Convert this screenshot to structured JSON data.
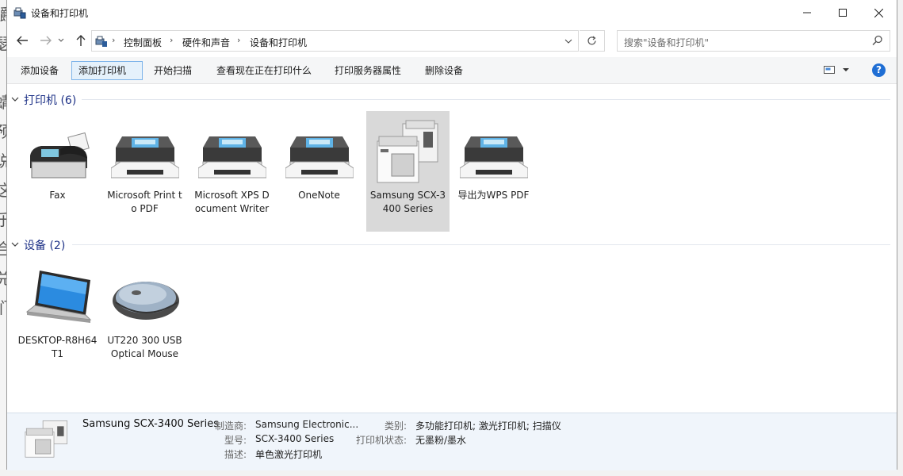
{
  "window": {
    "title": "设备和打印机"
  },
  "background_chars": [
    "嚼",
    "瑟",
    "",
    "蜻",
    "预",
    "说",
    "这",
    "乐",
    "合",
    "兑",
    "们",
    ""
  ],
  "address": {
    "crumbs": [
      "控制面板",
      "硬件和声音",
      "设备和打印机"
    ]
  },
  "search": {
    "placeholder": "搜索\"设备和打印机\""
  },
  "toolbar": {
    "add_device": "添加设备",
    "add_printer": "添加打印机",
    "start_scan": "开始扫描",
    "see_printing": "查看现在正在打印什么",
    "print_server": "打印服务器属性",
    "remove_device": "删除设备",
    "help": "?"
  },
  "printers": {
    "header": "打印机 (6)",
    "items": [
      {
        "label": "Fax",
        "icon": "fax-icon"
      },
      {
        "label": "Microsoft Print to PDF",
        "icon": "printer-icon"
      },
      {
        "label": "Microsoft XPS Document Writer",
        "icon": "printer-icon"
      },
      {
        "label": "OneNote",
        "icon": "printer-icon"
      },
      {
        "label": "Samsung SCX-3400 Series",
        "icon": "multifunction-printer-icon",
        "selected": true
      },
      {
        "label": "导出为WPS PDF",
        "icon": "printer-icon"
      }
    ]
  },
  "devices": {
    "header": "设备 (2)",
    "items": [
      {
        "label": "DESKTOP-R8H64T1",
        "icon": "laptop-icon"
      },
      {
        "label": "UT220 300 USB Optical Mouse",
        "icon": "mouse-icon"
      }
    ]
  },
  "details": {
    "name": "Samsung SCX-3400 Series",
    "manufacturer_label": "制造商:",
    "manufacturer": "Samsung Electronic...",
    "model_label": "型号:",
    "model": "SCX-3400 Series",
    "description_label": "描述:",
    "description": "单色激光打印机",
    "category_label": "类别:",
    "category": "多功能打印机; 激光打印机; 扫描仪",
    "status_label": "打印机状态:",
    "status": "无墨粉/墨水"
  },
  "colors": {
    "accent": "#1e3287",
    "selection": "#d9d9d9",
    "details_bg": "#f0f5fb",
    "help_blue": "#1f6ed4"
  }
}
